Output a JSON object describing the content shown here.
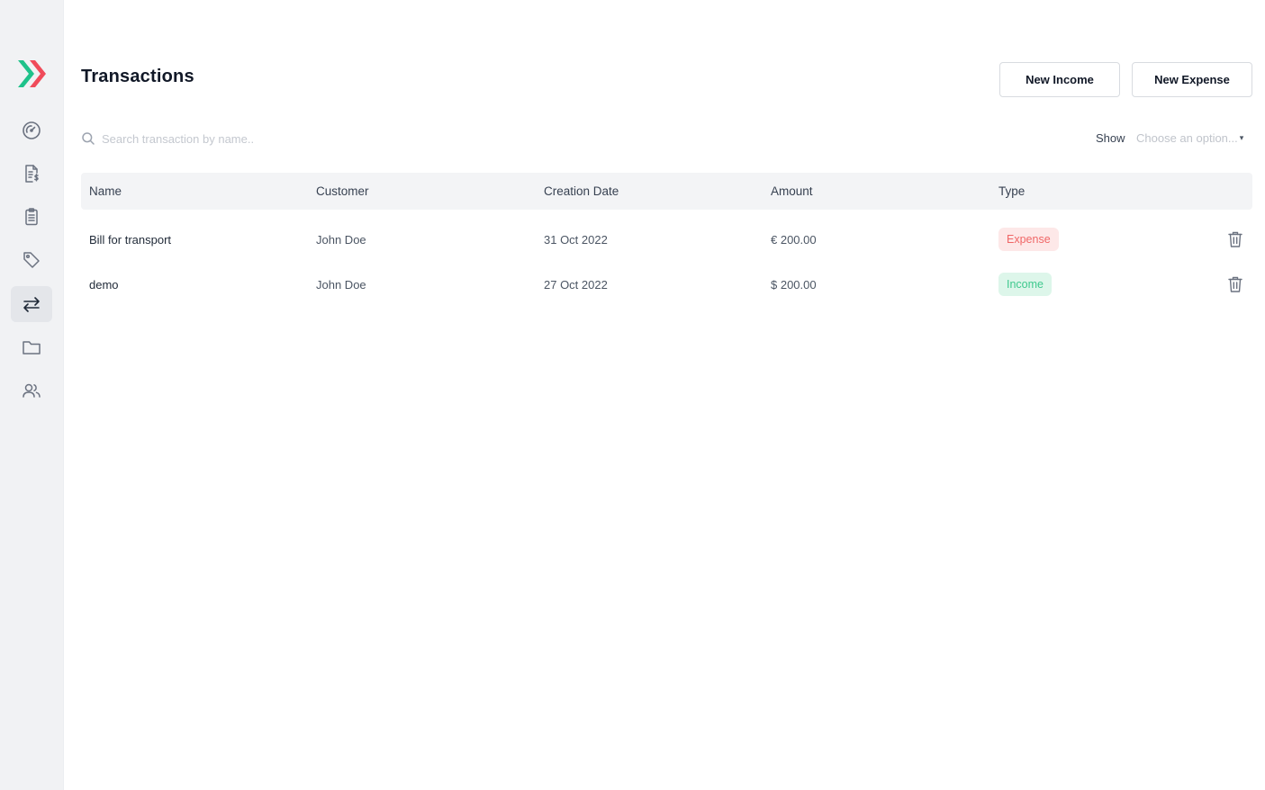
{
  "colors": {
    "logo_green": "#1fc28a",
    "logo_red": "#f04b5a",
    "expense_bg": "#fde8e8",
    "expense_text": "#f06767",
    "income_bg": "#ddf6ea",
    "income_text": "#3fc98e"
  },
  "sidebar": {
    "items": [
      {
        "icon": "dashboard-gauge-icon"
      },
      {
        "icon": "invoice-document-icon"
      },
      {
        "icon": "clipboard-list-icon"
      },
      {
        "icon": "tag-icon"
      },
      {
        "icon": "transfer-arrows-icon",
        "active": true
      },
      {
        "icon": "folder-icon"
      },
      {
        "icon": "users-icon"
      }
    ]
  },
  "header": {
    "title": "Transactions",
    "new_income_label": "New Income",
    "new_expense_label": "New Expense"
  },
  "filters": {
    "search_placeholder": "Search transaction by name..",
    "show_label": "Show",
    "select_value": "Choose an option..."
  },
  "table": {
    "columns": [
      "Name",
      "Customer",
      "Creation Date",
      "Amount",
      "Type"
    ],
    "rows": [
      {
        "name": "Bill for transport",
        "customer": "John Doe",
        "date": "31 Oct 2022",
        "amount": "€ 200.00",
        "type": "Expense"
      },
      {
        "name": "demo",
        "customer": "John Doe",
        "date": "27 Oct 2022",
        "amount": "$ 200.00",
        "type": "Income"
      }
    ]
  }
}
